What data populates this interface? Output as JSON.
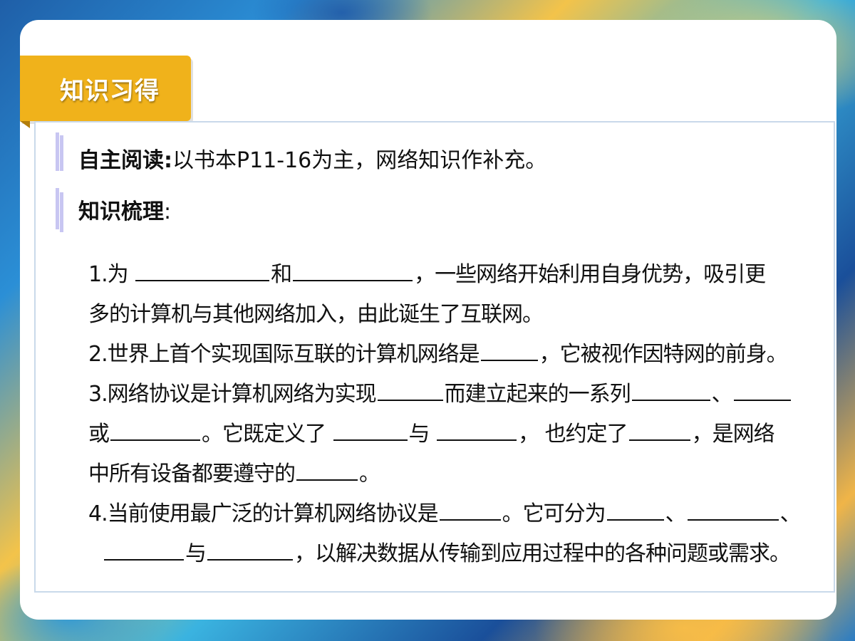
{
  "section_tag": "知识习得",
  "reading": {
    "label": "自主阅读:",
    "text": "以书本P11-16为主，网络知识作补充。"
  },
  "outline": {
    "label": "知识梳理",
    "suffix": ":"
  },
  "items": {
    "q1_a": "1.为",
    "q1_b": "和",
    "q1_c": "，一些网络开始利用自身优势，吸引更",
    "q1_d": "多的计算机与其他网络加入，由此诞生了互联网。",
    "q2_a": "2.世界上首个实现国际互联的计算机网络是",
    "q2_b": "，它被视作因特网的前身。",
    "q3_a": "3.网络协议是计算机网络为实现",
    "q3_b": "而建立起来的一系列",
    "q3_c": "、",
    "q3_d": "或",
    "q3_e": "。它既定义了",
    "q3_f": "与",
    "q3_g": "，  也约定了",
    "q3_h": "，是网络",
    "q3_i": "中所有设备都要遵守的",
    "q3_j": "。",
    "q4_a": "4.当前使用最广泛的计算机网络协议是",
    "q4_b": "。它可分为",
    "q4_c": "、",
    "q4_d": "、",
    "q4_e": "与",
    "q4_f": "，以解决数据从传输到应用过程中的各种问题或需求。"
  }
}
